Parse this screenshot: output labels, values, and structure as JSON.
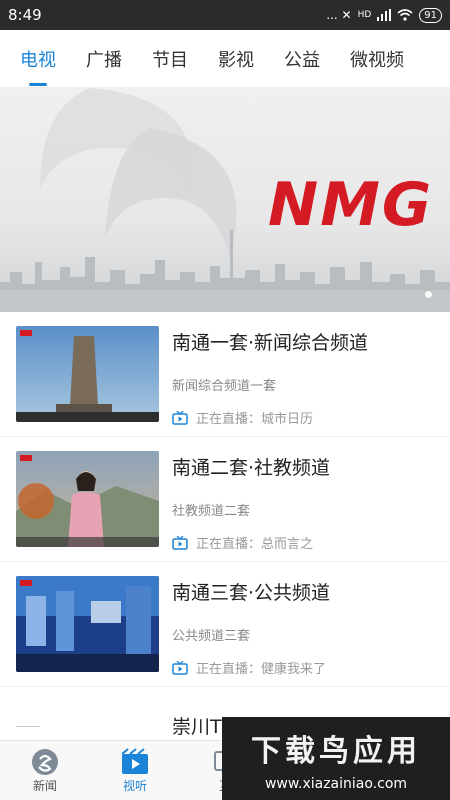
{
  "status_bar": {
    "time": "8:49",
    "indicators": "... ✕",
    "network": "HD",
    "battery": "91"
  },
  "tabs": [
    {
      "label": "电视",
      "active": true
    },
    {
      "label": "广播"
    },
    {
      "label": "节目"
    },
    {
      "label": "影视"
    },
    {
      "label": "公益"
    },
    {
      "label": "微视频"
    }
  ],
  "banner": {
    "logo_text": "NMG"
  },
  "channels": [
    {
      "title": "南通一套·新闻综合频道",
      "subtitle": "新闻综合频道一套",
      "live": "正在直播：城市日历"
    },
    {
      "title": "南通二套·社教频道",
      "subtitle": "社教频道二套",
      "live": "正在直播：总而言之"
    },
    {
      "title": "南通三套·公共频道",
      "subtitle": "公共频道三套",
      "live": "正在直播：健康我来了"
    }
  ],
  "partial_item": {
    "title": "崇川T"
  },
  "bottom_nav": [
    {
      "label": "新闻",
      "icon": "news-icon"
    },
    {
      "label": "视听",
      "icon": "video-icon",
      "active": true
    },
    {
      "label": "互",
      "icon": "interact-icon"
    }
  ],
  "watermark": {
    "title": "下载鸟应用",
    "url": "www.xiazainiao.com"
  },
  "colors": {
    "accent": "#1b84d6",
    "logo_red": "#d41a22"
  }
}
